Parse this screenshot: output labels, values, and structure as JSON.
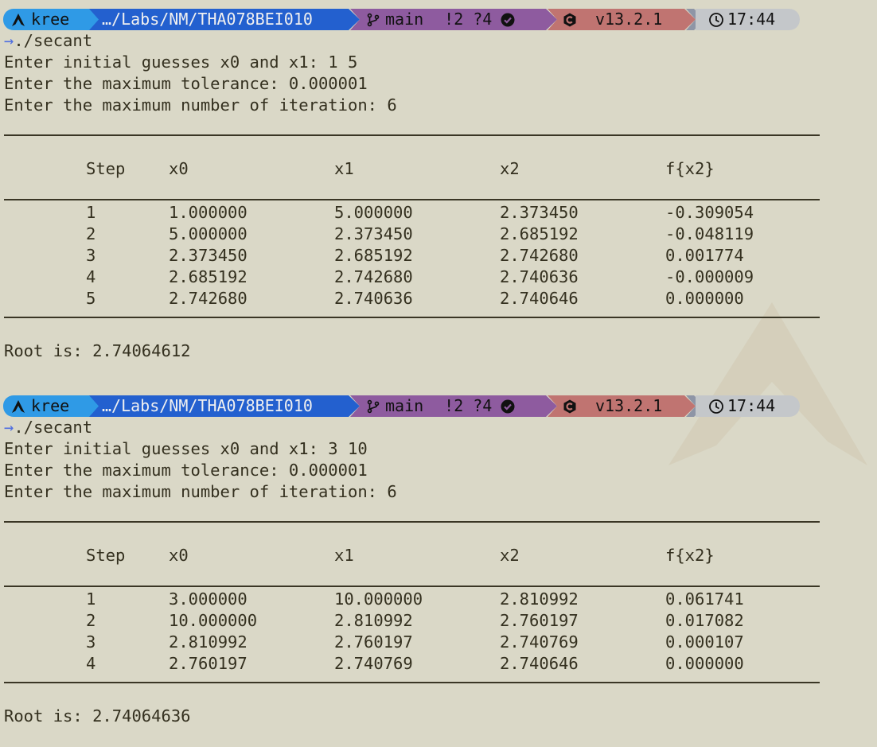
{
  "colors": {
    "background": "#dad8c7",
    "text": "#34301f",
    "prompt_arrow": "#4f6ee0",
    "segment_user": "#2f9ae6",
    "segment_path": "#2360cf",
    "segment_git": "#8e5b9f",
    "segment_lang": "#c07471",
    "segment_time": "#c4c7ca"
  },
  "runs": [
    {
      "prompt": {
        "user": "kree",
        "path": "…/Labs/NM/THA078BEI010",
        "branch": "main",
        "git_modified": "!2",
        "git_untracked": "?4",
        "lang_version": "v13.2.1",
        "time": "17:44"
      },
      "command": "./secant",
      "input_lines": [
        "Enter initial guesses x0 and x1: 1 5",
        "Enter the maximum tolerance: 0.000001",
        "Enter the maximum number of iteration: 6"
      ],
      "table": {
        "headers": [
          "Step",
          "x0",
          "x1",
          "x2",
          "f{x2}"
        ],
        "rows": [
          [
            "1",
            "1.000000",
            "5.000000",
            "2.373450",
            "-0.309054"
          ],
          [
            "2",
            "5.000000",
            "2.373450",
            "2.685192",
            "-0.048119"
          ],
          [
            "3",
            "2.373450",
            "2.685192",
            "2.742680",
            "0.001774"
          ],
          [
            "4",
            "2.685192",
            "2.742680",
            "2.740636",
            "-0.000009"
          ],
          [
            "5",
            "2.742680",
            "2.740636",
            "2.740646",
            "0.000000"
          ]
        ]
      },
      "result": "Root is: 2.74064612"
    },
    {
      "prompt": {
        "user": "kree",
        "path": "…/Labs/NM/THA078BEI010",
        "branch": "main",
        "git_modified": "!2",
        "git_untracked": "?4",
        "lang_version": "v13.2.1",
        "time": "17:44"
      },
      "command": "./secant",
      "input_lines": [
        "Enter initial guesses x0 and x1: 3 10",
        "Enter the maximum tolerance: 0.000001",
        "Enter the maximum number of iteration: 6"
      ],
      "table": {
        "headers": [
          "Step",
          "x0",
          "x1",
          "x2",
          "f{x2}"
        ],
        "rows": [
          [
            "1",
            "3.000000",
            "10.000000",
            "2.810992",
            "0.061741"
          ],
          [
            "2",
            "10.000000",
            "2.810992",
            "2.760197",
            "0.017082"
          ],
          [
            "3",
            "2.810992",
            "2.760197",
            "2.740769",
            "0.000107"
          ],
          [
            "4",
            "2.760197",
            "2.740769",
            "2.740646",
            "0.000000"
          ]
        ]
      },
      "result": "Root is: 2.74064636"
    }
  ]
}
